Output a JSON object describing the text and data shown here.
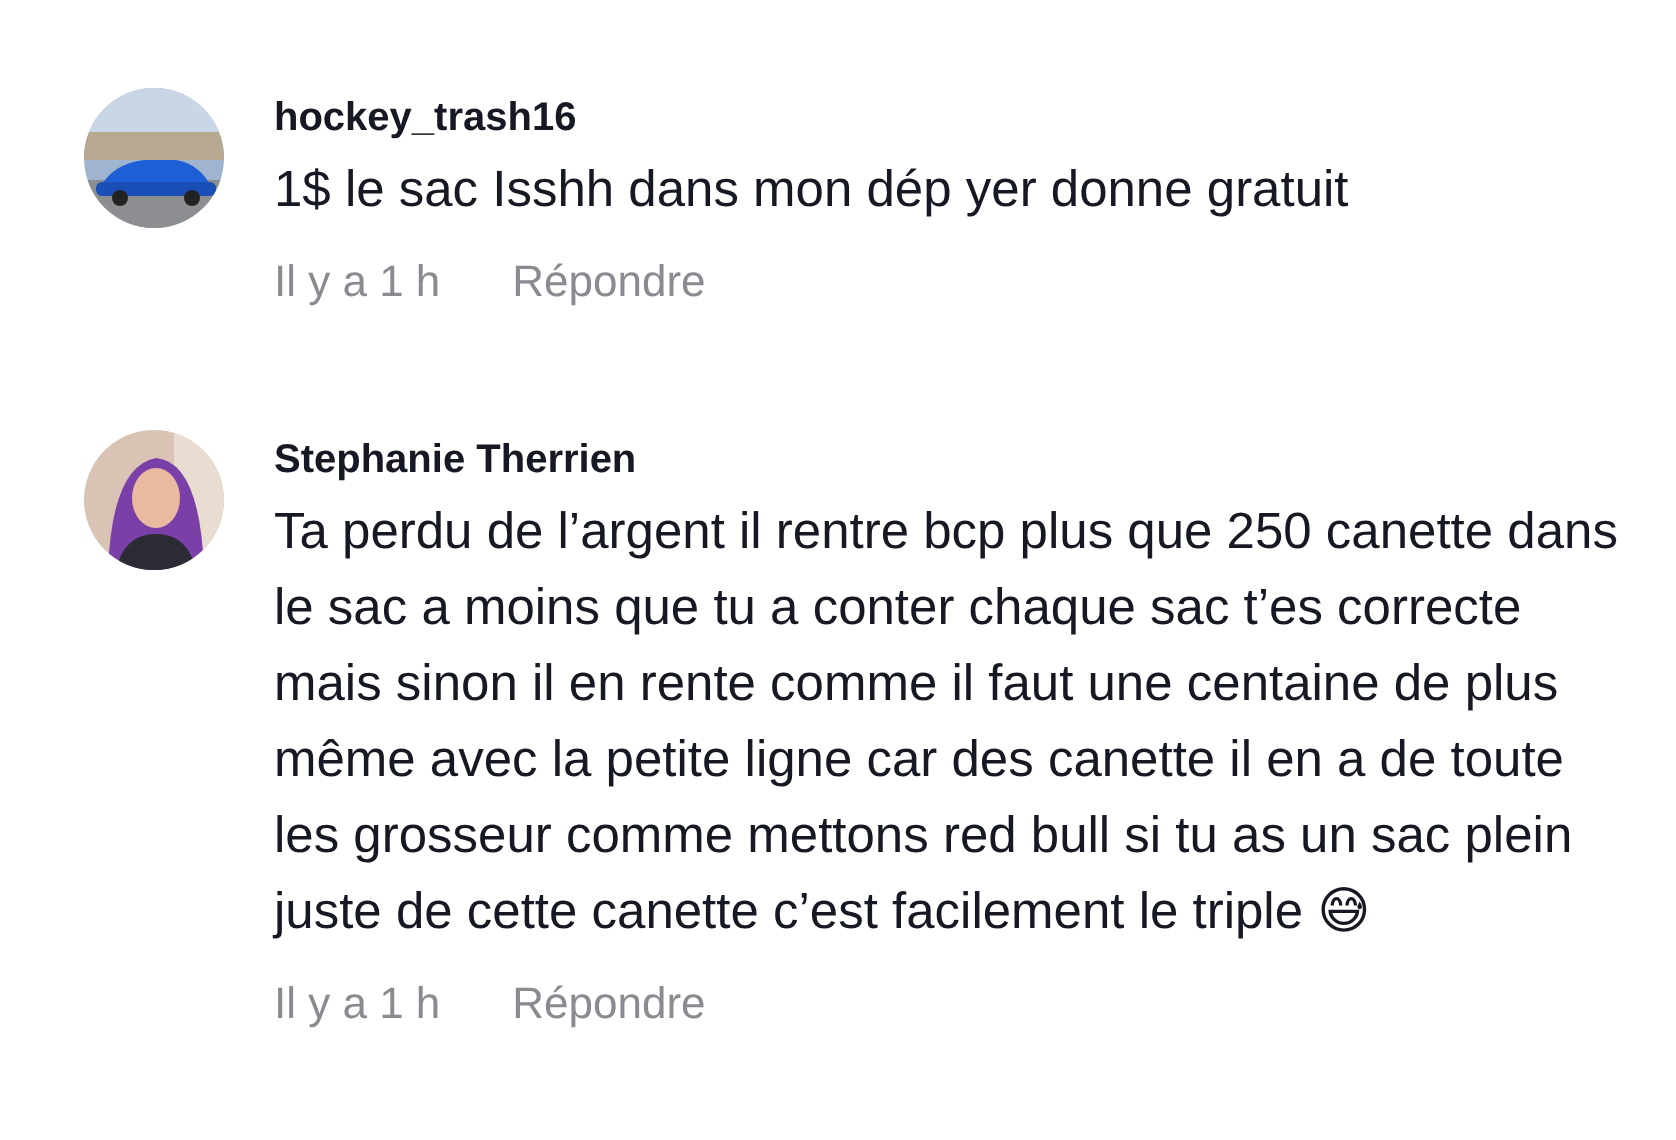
{
  "comments": [
    {
      "username": "hockey_trash16",
      "text": "1$ le sac Isshh dans mon dép yer donne gratuit",
      "time": "Il y a 1 h",
      "reply": "Répondre"
    },
    {
      "username": "Stephanie Therrien",
      "text": "Ta perdu de l’argent il rentre bcp plus que 250 canette dans le sac a moins que tu a conter chaque sac t’es correcte mais sinon il en rente comme il faut une centaine de plus même avec la petite ligne car des canette il en a de toute les grosseur comme mettons red bull si tu as un sac plein juste de cette canette c’est facilement le triple 😅",
      "time": "Il y a 1 h",
      "reply": "Répondre"
    }
  ]
}
